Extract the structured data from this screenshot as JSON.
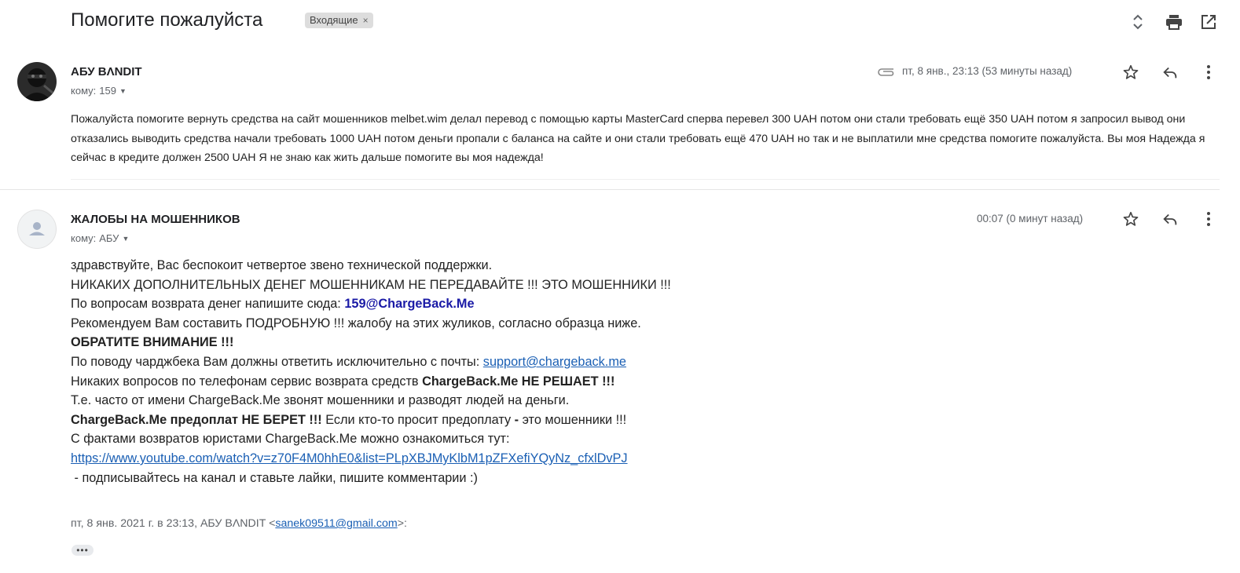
{
  "thread": {
    "subject": "Помогите пожалуйста",
    "label": "Входящие",
    "label_remove": "×"
  },
  "toolbar": {
    "expand_icon": "unfold-more-icon",
    "print_icon": "print-icon",
    "open_new_window_icon": "open-in-new-icon"
  },
  "message1": {
    "sender": "АБУ BΛNDIT",
    "to_prefix": "кому:",
    "to": "159",
    "date": "пт, 8 янв., 23:13 (53 минуты назад)",
    "attachment_icon": "paperclip-icon",
    "body": "Пожалуйста помогите вернуть средства на сайт мошенников melbet.wim делал перевод с помощью карты MasterCard сперва перевел 300 UAH потом они стали требовать ещё 350 UAH потом я запросил вывод они отказались выводить средства начали требовать 1000 UAH потом деньги пропали с баланса на сайте и они стали требовать ещё 470 UAH но так и не выплатили мне средства помогите пожалуйста. Вы моя Надежда я сейчас в кредите должен 2500 UAH Я не знаю как жить дальше помогите вы моя надежда!"
  },
  "message2": {
    "sender": "ЖАЛОБЫ НА МОШЕННИКОВ",
    "to_prefix": "кому:",
    "to": "АБУ",
    "date": "00:07 (0 минут назад)",
    "lines": {
      "l1": "здравствуйте, Вас беспокоит четвертое звено технической поддержки.",
      "l2": "НИКАКИХ ДОПОЛНИТЕЛЬНЫХ ДЕНЕГ МОШЕННИКАМ НЕ ПЕРЕДАВАЙТЕ !!! ЭТО МОШЕННИКИ !!!",
      "l3_text": "По вопросам возврата денег напишите сюда: ",
      "l3_email": "159@ChargeBack.Me",
      "l4": "Рекомендуем Вам составить ПОДРОБНУЮ !!! жалобу на этих жуликов, согласно образца ниже.",
      "l5": "ОБРАТИТЕ ВНИМАНИЕ !!!",
      "l6_text": "По поводу чарджбека Вам должны ответить исключительно с почты: ",
      "l6_link": "support@chargeback.me",
      "l7_text": "Никаких вопросов по телефонам сервис возврата средств ",
      "l7_bold": "ChargeBack.Me НЕ РЕШАЕТ !!!",
      "l8": "Т.е. часто от имени ChargeBack.Me звонят мошенники и разводят людей на деньги.",
      "l9_bold": "ChargeBack.Me предоплат НЕ БЕРЕТ !!!",
      "l9_text": " Если кто-то просит предоплату",
      "l9_dash": " - ",
      "l9_tail": "это мошенники !!!",
      "l10": "С фактами возвратов юристами ChargeBack.Me можно ознакомиться тут:",
      "l11_link": "https://www.youtube.com/watch?v=z70F4M0hhE0&list=PLpXBJMyKlbM1pZFXefiYQyNz_cfxlDvPJ",
      "l12": " - подписывайтесь на канал и ставьте лайки, пишите комментарии :)"
    },
    "quote_prefix": "пт, 8 янв. 2021 г. в 23:13, АБУ BΛNDIT <",
    "quote_email": "sanek09511@gmail.com",
    "quote_suffix": ">:",
    "trimmed_label": "•••"
  },
  "actions": {
    "star_icon": "star-icon",
    "reply_icon": "reply-icon",
    "more_icon": "more-vert-icon"
  },
  "colors": {
    "link": "#1a5fb4",
    "email_highlight": "#1a1aa6",
    "secondary_text": "#5f6368",
    "icon": "#5f6368"
  }
}
